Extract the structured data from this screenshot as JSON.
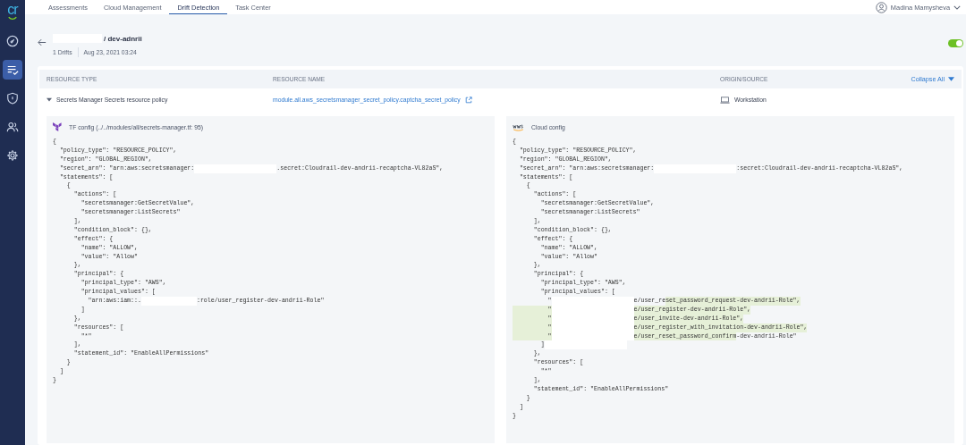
{
  "logo": {
    "text": "cr"
  },
  "sidebar": {
    "items": [
      {
        "selected": false
      },
      {
        "selected": true
      },
      {
        "selected": false
      },
      {
        "selected": false
      },
      {
        "selected": false
      }
    ]
  },
  "tabs": [
    {
      "label": "Assessments",
      "selected": false
    },
    {
      "label": "Cloud Management",
      "selected": false
    },
    {
      "label": "Drift Detection",
      "selected": true
    },
    {
      "label": "Task Center",
      "selected": false
    }
  ],
  "user": {
    "name": "Madina Mamysheva"
  },
  "header": {
    "title": "/ dev-adnrii",
    "title_redacted": true,
    "drifts": "1 Drifts",
    "date": "Aug 23, 2021 03:24",
    "toggle_on": true
  },
  "table": {
    "columns": [
      "RESOURCE TYPE",
      "RESOURCE NAME",
      "ORIGIN/SOURCE"
    ],
    "collapse_label": "Collapse All",
    "row": {
      "expanded": true,
      "type": "Secrets Manager Secrets resource policy",
      "name": "module.all.aws_secretsmanager_secret_policy.captcha_secret_policy",
      "origin": "Workstation"
    }
  },
  "panels": [
    {
      "kind": "terraform",
      "title": "TF config (../../modules/all/secrets-manager.tf: 95)",
      "lines": [
        [
          {
            "kind": "code",
            "text": "{",
            "changed": false
          }
        ],
        [
          {
            "kind": "code",
            "text": "  \"policy_type\": \"RESOURCE_POLICY\",",
            "changed": false
          }
        ],
        [
          {
            "kind": "code",
            "text": "  \"region\": \"GLOBAL_REGION\",",
            "changed": false
          }
        ],
        [
          {
            "kind": "code",
            "text": "  \"secret_arn\": \"arn:aws:secretsmanager:",
            "changed": false
          },
          {
            "kind": "redacted"
          },
          {
            "kind": "code",
            "text": ".secret:Cloudrail-dev-andrii-recaptcha-VL82aS\",",
            "changed": false
          }
        ],
        [
          {
            "kind": "code",
            "text": "  \"statements\": [",
            "changed": false
          }
        ],
        [
          {
            "kind": "code",
            "text": "    {",
            "changed": false
          }
        ],
        [
          {
            "kind": "code",
            "text": "      \"actions\": [",
            "changed": false
          }
        ],
        [
          {
            "kind": "code",
            "text": "        \"secretsmanager:GetSecretValue\",",
            "changed": false
          }
        ],
        [
          {
            "kind": "code",
            "text": "        \"secretsmanager:ListSecrets\"",
            "changed": false
          }
        ],
        [
          {
            "kind": "code",
            "text": "      ],",
            "changed": false
          }
        ],
        [
          {
            "kind": "code",
            "text": "      \"condition_block\": {},",
            "changed": false
          }
        ],
        [
          {
            "kind": "code",
            "text": "      \"effect\": {",
            "changed": false
          }
        ],
        [
          {
            "kind": "code",
            "text": "        \"name\": \"ALLOW\",",
            "changed": false
          }
        ],
        [
          {
            "kind": "code",
            "text": "        \"value\": \"Allow\"",
            "changed": false
          }
        ],
        [
          {
            "kind": "code",
            "text": "      },",
            "changed": false
          }
        ],
        [
          {
            "kind": "code",
            "text": "      \"principal\": {",
            "changed": false
          }
        ],
        [
          {
            "kind": "code",
            "text": "        \"principal_type\": \"AWS\",",
            "changed": false
          }
        ],
        [
          {
            "kind": "code",
            "text": "        \"principal_values\": [",
            "changed": false
          }
        ],
        [
          {
            "kind": "code",
            "text": "          \"arn:aws:iam::.",
            "changed": false
          },
          {
            "kind": "redacted"
          },
          {
            "kind": "code",
            "text": ":role/user_register-dev-andrii-Role\"",
            "changed": false
          }
        ],
        [
          {
            "kind": "code",
            "text": "        ]",
            "changed": false
          }
        ],
        [
          {
            "kind": "code",
            "text": "      },",
            "changed": false
          }
        ],
        [
          {
            "kind": "code",
            "text": "      \"resources\": [",
            "changed": false
          }
        ],
        [
          {
            "kind": "code",
            "text": "        \"*\"",
            "changed": false
          }
        ],
        [
          {
            "kind": "code",
            "text": "      ],",
            "changed": false
          }
        ],
        [
          {
            "kind": "code",
            "text": "      \"statement_id\": \"EnableAllPermissions\"",
            "changed": false
          }
        ],
        [
          {
            "kind": "code",
            "text": "    }",
            "changed": false
          }
        ],
        [
          {
            "kind": "code",
            "text": "  ]",
            "changed": false
          }
        ],
        [
          {
            "kind": "code",
            "text": "}",
            "changed": false
          }
        ]
      ]
    },
    {
      "kind": "aws",
      "title": "Cloud config",
      "lines": [
        [
          {
            "kind": "code",
            "text": "{",
            "changed": false
          }
        ],
        [
          {
            "kind": "code",
            "text": "  \"policy_type\": \"RESOURCE_POLICY\",",
            "changed": false
          }
        ],
        [
          {
            "kind": "code",
            "text": "  \"region\": \"GLOBAL_REGION\",",
            "changed": false
          }
        ],
        [
          {
            "kind": "code",
            "text": "  \"secret_arn\": \"arn:aws:secretsmanager:",
            "changed": false
          },
          {
            "kind": "redacted"
          },
          {
            "kind": "code",
            "text": ":secret:Cloudrail-dev-andrii-recaptcha-VL82aS\",",
            "changed": false
          }
        ],
        [
          {
            "kind": "code",
            "text": "  \"statements\": [",
            "changed": false
          }
        ],
        [
          {
            "kind": "code",
            "text": "    {",
            "changed": false
          }
        ],
        [
          {
            "kind": "code",
            "text": "      \"actions\": [",
            "changed": false
          }
        ],
        [
          {
            "kind": "code",
            "text": "        \"secretsmanager:GetSecretValue\",",
            "changed": false
          }
        ],
        [
          {
            "kind": "code",
            "text": "        \"secretsmanager:ListSecrets\"",
            "changed": false
          }
        ],
        [
          {
            "kind": "code",
            "text": "      ],",
            "changed": false
          }
        ],
        [
          {
            "kind": "code",
            "text": "      \"condition_block\": {},",
            "changed": false
          }
        ],
        [
          {
            "kind": "code",
            "text": "      \"effect\": {",
            "changed": false
          }
        ],
        [
          {
            "kind": "code",
            "text": "        \"name\": \"ALLOW\",",
            "changed": false
          }
        ],
        [
          {
            "kind": "code",
            "text": "        \"value\": \"Allow\"",
            "changed": false
          }
        ],
        [
          {
            "kind": "code",
            "text": "      },",
            "changed": false
          }
        ],
        [
          {
            "kind": "code",
            "text": "      \"principal\": {",
            "changed": false
          }
        ],
        [
          {
            "kind": "code",
            "text": "        \"principal_type\": \"AWS\",",
            "changed": false
          }
        ],
        [
          {
            "kind": "code",
            "text": "        \"principal_values\": [",
            "changed": false
          }
        ],
        [
          {
            "kind": "code",
            "text": "          \"",
            "changed": false
          },
          {
            "kind": "redacted"
          },
          {
            "kind": "code",
            "text": "e/user_re",
            "changed": false
          },
          {
            "kind": "code",
            "text": "set_password_request-dev-andrii-Role\",",
            "changed": true
          }
        ],
        [
          {
            "kind": "code",
            "text": "          \"",
            "changed": true
          },
          {
            "kind": "redacted"
          },
          {
            "kind": "code",
            "text": "e/user_register-dev-andrii-Role\",",
            "changed": true
          }
        ],
        [
          {
            "kind": "code",
            "text": "          \"",
            "changed": true
          },
          {
            "kind": "redacted"
          },
          {
            "kind": "code",
            "text": "e/user_invite-dev-andrii-Role\",",
            "changed": true
          }
        ],
        [
          {
            "kind": "code",
            "text": "          \"",
            "changed": true
          },
          {
            "kind": "redacted"
          },
          {
            "kind": "code",
            "text": "e/user_register_with_invitation-dev-andrii-Role\",",
            "changed": true
          }
        ],
        [
          {
            "kind": "code",
            "text": "          \"",
            "changed": true
          },
          {
            "kind": "redacted"
          },
          {
            "kind": "code",
            "text": "e/user_reset_password_confirm",
            "changed": true
          },
          {
            "kind": "code",
            "text": "-dev-andrii-Role\"",
            "changed": false
          }
        ],
        [
          {
            "kind": "code",
            "text": "        ]",
            "changed": false
          },
          {
            "kind": "redacted"
          }
        ],
        [
          {
            "kind": "code",
            "text": "      },",
            "changed": false
          }
        ],
        [
          {
            "kind": "code",
            "text": "      \"resources\": [",
            "changed": false
          }
        ],
        [
          {
            "kind": "code",
            "text": "        \"*\"",
            "changed": false
          }
        ],
        [
          {
            "kind": "code",
            "text": "      ],",
            "changed": false
          }
        ],
        [
          {
            "kind": "code",
            "text": "      \"statement_id\": \"EnableAllPermissions\"",
            "changed": false
          }
        ],
        [
          {
            "kind": "code",
            "text": "    }",
            "changed": false
          }
        ],
        [
          {
            "kind": "code",
            "text": "  ]",
            "changed": false
          }
        ],
        [
          {
            "kind": "code",
            "text": "}",
            "changed": false
          }
        ]
      ]
    }
  ]
}
